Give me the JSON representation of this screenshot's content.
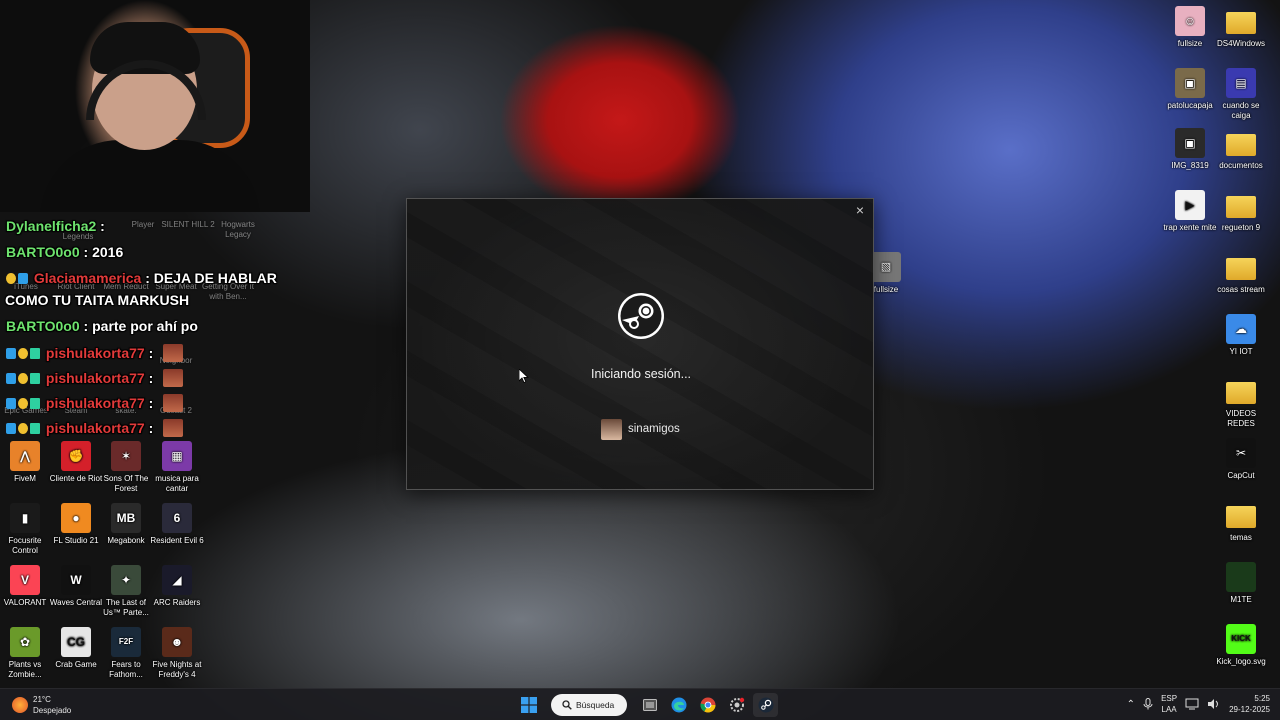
{
  "chat": [
    {
      "user": "Dylanelficha2",
      "sep": ":",
      "message": "",
      "user_color": "green"
    },
    {
      "user": "BARTO0o0",
      "sep": ":",
      "message": "2016",
      "user_color": "green"
    },
    {
      "user": "Glaciamamerica",
      "sep": ":",
      "message": "DEJA DE HABLAR",
      "cont": "COMO TU TAITA MARKUSH",
      "user_color": "red"
    },
    {
      "user": "BARTO0o0",
      "sep": ":",
      "message": "parte por ahí po",
      "user_color": "green"
    },
    {
      "user": "pishulakorta77",
      "sep": ":",
      "message": "",
      "user_color": "red"
    },
    {
      "user": "pishulakorta77",
      "sep": ":",
      "message": "",
      "user_color": "red"
    },
    {
      "user": "pishulakorta77",
      "sep": ":",
      "message": "",
      "user_color": "red"
    },
    {
      "user": "pishulakorta77",
      "sep": ":",
      "message": "",
      "user_color": "red"
    }
  ],
  "faded_icons": [
    "Player",
    "SILENT HILL 2",
    "Hogwarts Legacy",
    "Legends",
    "iTunes",
    "Riot Client",
    "Mem Reduct",
    "Super Meat",
    "Getting Over It with Ben...",
    "Epic Games",
    "Steam",
    "skate.",
    "Outlast 2",
    "Neighbor"
  ],
  "left_icons": [
    {
      "label": "FiveM",
      "color": "#e8822a",
      "glyph": "⋀"
    },
    {
      "label": "Cliente de Riot",
      "color": "#d4202a",
      "glyph": "✊"
    },
    {
      "label": "Sons Of The Forest",
      "color": "#6a2a2a",
      "glyph": "✶"
    },
    {
      "label": "musica para cantar",
      "color": "#7c3aa8",
      "glyph": "▦"
    },
    {
      "label": "Focusrite Control",
      "color": "#1a1a1a",
      "glyph": "▮"
    },
    {
      "label": "FL Studio 21",
      "color": "#f08a20",
      "glyph": "●"
    },
    {
      "label": "Megabonk",
      "color": "#2a2a2a",
      "glyph": "MB"
    },
    {
      "label": "Resident Evil 6",
      "color": "#2a2a3a",
      "glyph": "6"
    },
    {
      "label": "VALORANT",
      "color": "#fb4454",
      "glyph": "V"
    },
    {
      "label": "Waves Central",
      "color": "#111111",
      "glyph": "W"
    },
    {
      "label": "The Last of Us™ Parte...",
      "color": "#3a4a3a",
      "glyph": "✦"
    },
    {
      "label": "ARC Raiders",
      "color": "#1a1a2a",
      "glyph": "◢"
    },
    {
      "label": "Plants vs Zombie...",
      "color": "#6a9a2a",
      "glyph": "✿"
    },
    {
      "label": "Crab Game",
      "color": "#e6e6e6",
      "glyph": "CG"
    },
    {
      "label": "Fears to Fathom...",
      "color": "#1a2a3a",
      "glyph": "F2F"
    },
    {
      "label": "Five Nights at Freddy's 4",
      "color": "#5a2a1a",
      "glyph": "☻"
    }
  ],
  "right_icons": [
    {
      "label": "fullsize",
      "color": "#e8b0c0",
      "glyph": "☺",
      "folder": false
    },
    {
      "label": "DS4Windows",
      "color": "#4aa0e0",
      "glyph": "",
      "folder": true
    },
    {
      "label": "patolucapaja",
      "color": "#7a6a4a",
      "glyph": "▣",
      "folder": false
    },
    {
      "label": "cuando se caiga",
      "color": "#3a3ab0",
      "glyph": "▤",
      "folder": false
    },
    {
      "label": "IMG_8319",
      "color": "#2a2a2a",
      "glyph": "▣",
      "folder": false
    },
    {
      "label": "documentos",
      "color": "",
      "glyph": "",
      "folder": true
    },
    {
      "label": "trap xente mite",
      "color": "#f2f2f2",
      "glyph": "▶",
      "folder": false
    },
    {
      "label": "regueton 9",
      "color": "",
      "glyph": "",
      "folder": true
    },
    {
      "label": "cosas stream",
      "color": "",
      "glyph": "",
      "folder": true
    },
    {
      "label": "YI IOT",
      "color": "#3a8ae8",
      "glyph": "☁",
      "folder": false
    },
    {
      "label": "VIDEOS REDES",
      "color": "",
      "glyph": "",
      "folder": true
    },
    {
      "label": "CapCut",
      "color": "#111111",
      "glyph": "✂",
      "folder": false
    },
    {
      "label": "temas",
      "color": "",
      "glyph": "",
      "folder": true
    },
    {
      "label": "M1TE",
      "color": "#1a3a1a",
      "glyph": "",
      "folder": false
    },
    {
      "label": "Kick_logo.svg",
      "color": "#53fc18",
      "glyph": "KICK",
      "folder": false
    }
  ],
  "center_icon": {
    "label": "fullsize"
  },
  "steam_dialog": {
    "status": "Iniciando sesión...",
    "account": "sinamigos",
    "close_symbol": "×"
  },
  "taskbar": {
    "weather_temp": "21°C",
    "weather_desc": "Despejado",
    "search_label": "Búsqueda",
    "lang_top": "ESP",
    "lang_bottom": "LAA",
    "time": "5:25",
    "date": "29-12-2025"
  },
  "colors": {
    "steam_blue": "#1b2838",
    "taskbar_bg": "#1c1c20",
    "kick_green": "#53fc18"
  }
}
